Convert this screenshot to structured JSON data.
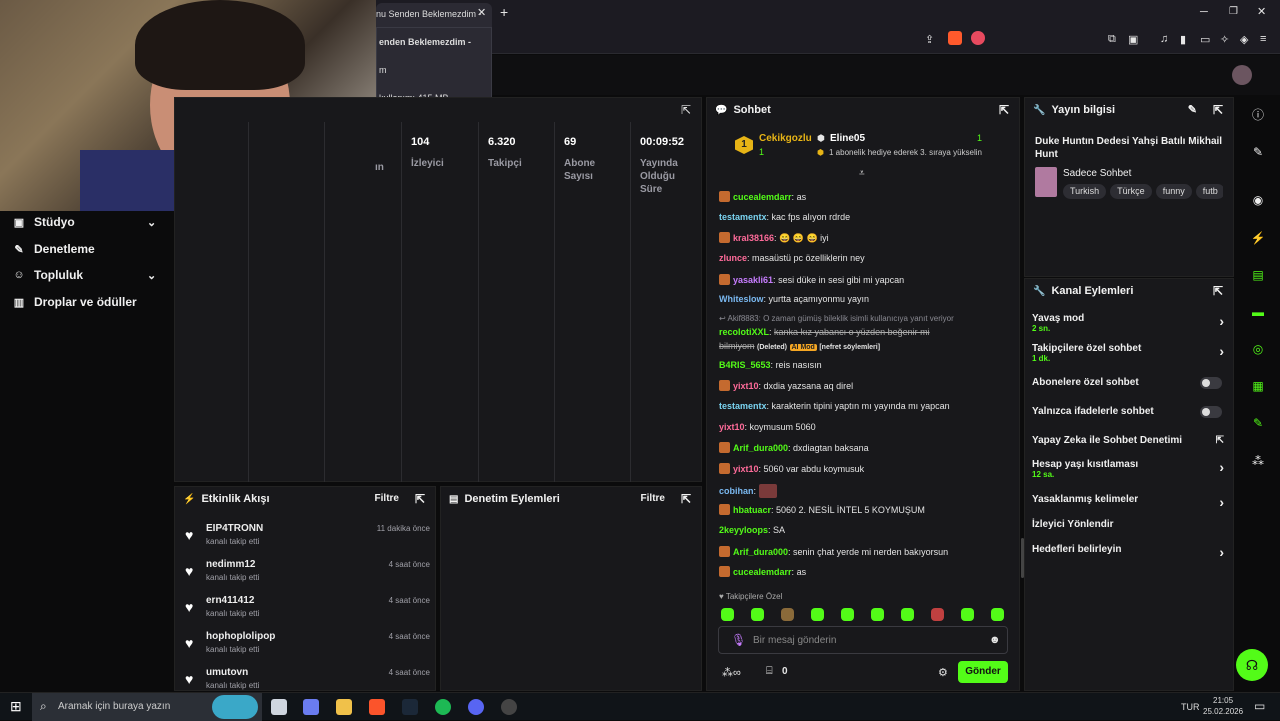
{
  "browser": {
    "tab_title": "nu Senden Beklemezdim -",
    "popup": {
      "title": "enden Beklemezdim -",
      "line2": "m",
      "memory": "kullanımı 415 MB"
    }
  },
  "nav": {
    "items": [
      {
        "label": "Stüdyo",
        "icon": "studio-icon",
        "has_chevron": true
      },
      {
        "label": "Denetleme",
        "icon": "wrench-icon",
        "has_chevron": false
      },
      {
        "label": "Topluluk",
        "icon": "people-icon",
        "has_chevron": true
      },
      {
        "label": "Droplar ve ödüller",
        "icon": "chart-icon",
        "has_chevron": false
      }
    ]
  },
  "stats": {
    "partial_label": "ın",
    "columns": [
      {
        "value": "104",
        "label": "İzleyici"
      },
      {
        "value": "6.320",
        "label": "Takipçi"
      },
      {
        "value": "69",
        "label": "Abone Sayısı"
      },
      {
        "value": "00:09:52",
        "label": "Yayında Olduğu Süre"
      }
    ]
  },
  "activity": {
    "title": "Etkinlik Akışı",
    "filter": "Filtre",
    "items": [
      {
        "name": "EIP4TRONN",
        "action": "kanalı takip etti",
        "time": "11 dakika önce"
      },
      {
        "name": "nedimm12",
        "action": "kanalı takip etti",
        "time": "4 saat önce"
      },
      {
        "name": "ern411412",
        "action": "kanalı takip etti",
        "time": "4 saat önce"
      },
      {
        "name": "hophoplolipop",
        "action": "kanalı takip etti",
        "time": "4 saat önce"
      },
      {
        "name": "umutovn",
        "action": "kanalı takip etti",
        "time": "4 saat önce"
      }
    ]
  },
  "moderation": {
    "title": "Denetim Eylemleri",
    "filter": "Filtre"
  },
  "chat": {
    "title": "Sohbet",
    "pinned": {
      "rank": "1",
      "user": "Cekikgozlu",
      "user_count": "1",
      "gifter": "Eline05",
      "gift_count": "1",
      "message": "1 abonelik hediye ederek 3. sıraya yükselin"
    },
    "messages": [
      {
        "user": "cucealemdarr",
        "text": "as",
        "color": "#53fc18"
      },
      {
        "user": "testamentx",
        "text": "kac fps alıyon rdrde",
        "color": "#7ad3f0"
      },
      {
        "user": "kral38166",
        "text": "😄 😄 😄 iyi",
        "color": "#ff6b9a"
      },
      {
        "user": "zlunce",
        "text": "masaüstü pc özelliklerin ney",
        "color": "#ff6b9a"
      },
      {
        "user": "yasakli61",
        "text": "sesi düke in sesi gibi mi yapcan",
        "color": "#c77dff"
      },
      {
        "user": "Whiteslow",
        "text": "yurtta açamıyonmu yayın",
        "color": "#7ab8f0"
      },
      {
        "user": "B4RIS_5653",
        "text": "reis nasısın",
        "color": "#53fc18"
      },
      {
        "user": "yixt10",
        "text": "dxdia yazsana aq direl",
        "color": "#ff6b9a"
      },
      {
        "user": "testamentx",
        "text": "karakterin tipini yaptın mı yayında mı yapcan",
        "color": "#7ad3f0"
      },
      {
        "user": "yixt10",
        "text": "koymusum 5060",
        "color": "#ff6b9a"
      },
      {
        "user": "Arif_dura000",
        "text": "dxdiagtan baksana",
        "color": "#53fc18"
      },
      {
        "user": "yixt10",
        "text": "5060 var abdu koymusuk",
        "color": "#ff6b9a"
      },
      {
        "user": "cobihan",
        "text": "",
        "color": "#7ab8f0"
      },
      {
        "user": "hbatuacr",
        "text": "5060 2. NESİL İNTEL 5 KOYMUŞUM",
        "color": "#53fc18"
      },
      {
        "user": "2keyyloops",
        "text": "SA",
        "color": "#53fc18"
      },
      {
        "user": "Arif_dura000",
        "text": "senin çhat yerde mi nerden bakıyorsun",
        "color": "#53fc18"
      },
      {
        "user": "cucealemdarr",
        "text": "as",
        "color": "#53fc18"
      }
    ],
    "reply_note": "Akif8883: O zaman gümüş bileklik isimli kullanıcıya yanıt veriyor",
    "deleted_msg": {
      "user": "recolotiXXL",
      "text": "kanka kız yabancı o yüzden beğenir mi",
      "text2": "bilmiyom",
      "tag1": "(Deleted)",
      "tag2": "AI Mod",
      "tag3": "[nefret söylemleri]"
    },
    "emote_section": "Takipçilere Özel",
    "input_placeholder": "Bir mesaj gönderin",
    "points": "0",
    "send": "Gönder"
  },
  "stream_info": {
    "title": "Yayın bilgisi",
    "stream_title": "Duke Huntın Dedesi Yahşi Batılı Mikhail Hunt",
    "category": "Sadece Sohbet",
    "tags": [
      "Turkish",
      "Türkçe",
      "funny",
      "futb"
    ]
  },
  "channel_actions": {
    "title": "Kanal Eylemleri",
    "rows": [
      {
        "label": "Yavaş mod",
        "sub": "2 sn.",
        "type": "arrow"
      },
      {
        "label": "Takipçilere özel sohbet",
        "sub": "1 dk.",
        "type": "arrow"
      },
      {
        "label": "Abonelere özel sohbet",
        "sub": "",
        "type": "toggle"
      },
      {
        "label": "Yalnızca ifadelerle sohbet",
        "sub": "",
        "type": "toggle"
      },
      {
        "label": "Yapay Zeka ile Sohbet Denetimi",
        "sub": "",
        "type": "external"
      },
      {
        "label": "Hesap yaşı kısıtlaması",
        "sub": "12 sa.",
        "type": "arrow"
      },
      {
        "label": "Yasaklanmış kelimeler",
        "sub": "",
        "type": "arrow"
      },
      {
        "label": "İzleyici Yönlendir",
        "sub": "",
        "type": "none"
      },
      {
        "label": "Hedefleri belirleyin",
        "sub": "",
        "type": "arrow"
      }
    ]
  },
  "taskbar": {
    "search_placeholder": "Aramak için buraya yazın",
    "lang": "TUR",
    "time": "21:05",
    "date": "25.02.2026"
  },
  "colors": {
    "accent": "#53fc18",
    "panel": "#18181b",
    "bg": "#0b0b0c"
  }
}
